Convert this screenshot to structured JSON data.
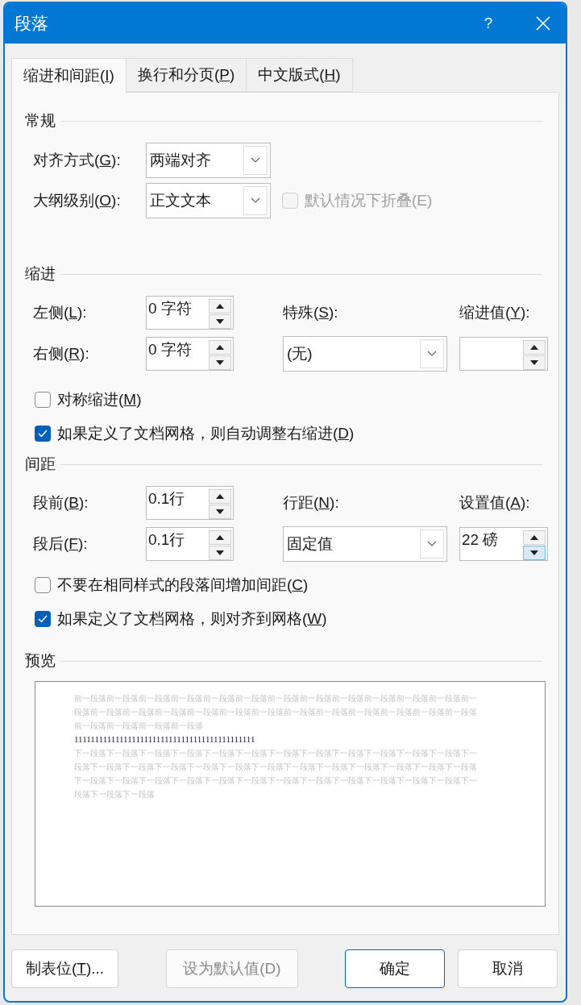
{
  "window": {
    "title": "段落",
    "help": "?"
  },
  "tabs": [
    {
      "label": {
        "text": "缩进和间距(",
        "key": "I",
        "after": ")"
      },
      "selected": true
    },
    {
      "label": {
        "text": "换行和分页(",
        "key": "P",
        "after": ")"
      },
      "selected": false
    },
    {
      "label": {
        "text": "中文版式(",
        "key": "H",
        "after": ")"
      },
      "selected": false
    }
  ],
  "general": {
    "heading": "常规",
    "alignment": {
      "label": {
        "text": "对齐方式(",
        "key": "G",
        "after": "):"
      },
      "value": "两端对齐"
    },
    "outline": {
      "label": {
        "text": "大纲级别(",
        "key": "O",
        "after": "):"
      },
      "value": "正文文本"
    },
    "collapse": {
      "label": {
        "text": "默认情况下折叠(E)"
      },
      "checked": false,
      "disabled": true
    }
  },
  "indent": {
    "heading": "缩进",
    "left": {
      "label": {
        "text": "左侧(",
        "key": "L",
        "after": "):"
      },
      "value": "0 字符"
    },
    "right": {
      "label": {
        "text": "右侧(",
        "key": "R",
        "after": "):"
      },
      "value": "0 字符"
    },
    "special": {
      "label": {
        "text": "特殊(",
        "key": "S",
        "after": "):"
      },
      "value": "(无)"
    },
    "by": {
      "label": {
        "text": "缩进值(",
        "key": "Y",
        "after": "):"
      }
    },
    "checks": [
      {
        "label": {
          "text": "对称缩进(",
          "key": "M",
          "after": ")"
        },
        "checked": false
      },
      {
        "label": {
          "text": "如果定义了文档网格，则自动调整右缩进(",
          "key": "D",
          "after": ")"
        },
        "checked": true
      }
    ]
  },
  "spacing": {
    "heading": "间距",
    "before": {
      "label": {
        "text": "段前(",
        "key": "B",
        "after": "):"
      },
      "value": "0.1行"
    },
    "after": {
      "label": {
        "text": "段后(",
        "key": "F",
        "after": "):"
      },
      "value": "0.1行"
    },
    "line": {
      "label": {
        "text": "行距(",
        "key": "N",
        "after": "):"
      },
      "value": "固定值"
    },
    "at": {
      "label": {
        "text": "设置值(",
        "key": "A",
        "after": "):"
      },
      "value": "22 磅"
    },
    "checks": [
      {
        "label": {
          "text": "不要在相同样式的段落间增加间距(",
          "key": "C",
          "after": ")"
        },
        "checked": false
      },
      {
        "label": {
          "text": "如果定义了文档网格，则对齐到网格(",
          "key": "W",
          "after": ")"
        },
        "checked": true
      }
    ]
  },
  "preview": {
    "heading": "预览",
    "previous": "前一段落前一段落前一段落前一段落前一段落前一段落前一段落前一段落前一段落前一段落前一段落前一段落前一段落前一段落前一段落前一段落前一段落前一段落前一段落前一段落前一段落前一段落前一段落前一段落前一段落前一段落前一段落前一段落前一段落",
    "current": "11111111111111111111111111111111111111111111",
    "next": "下一段落下一段落下一段落下一段落下一段落下一段落下一段落下一段落下一段落下一段落下一段落下一段落下一段落下一段落下一段落下一段落下一段落下一段落下一段落下一段落下一段落下一段落下一段落下一段落下一段落下一段落下一段落下一段落下一段落下一段落下一段落下一段落下一段落下一段落下一段落下一段落下一段落下一段落下一段落下一段落"
  },
  "buttons": [
    {
      "label": {
        "text": "制表位(",
        "key": "T",
        "after": ")..."
      },
      "kind": "normal"
    },
    {
      "label": {
        "text": "设为默认值(D)"
      },
      "kind": "disabled"
    },
    {
      "label": {
        "text": "确定"
      },
      "kind": "default"
    },
    {
      "label": {
        "text": "取消"
      },
      "kind": "normal"
    }
  ]
}
